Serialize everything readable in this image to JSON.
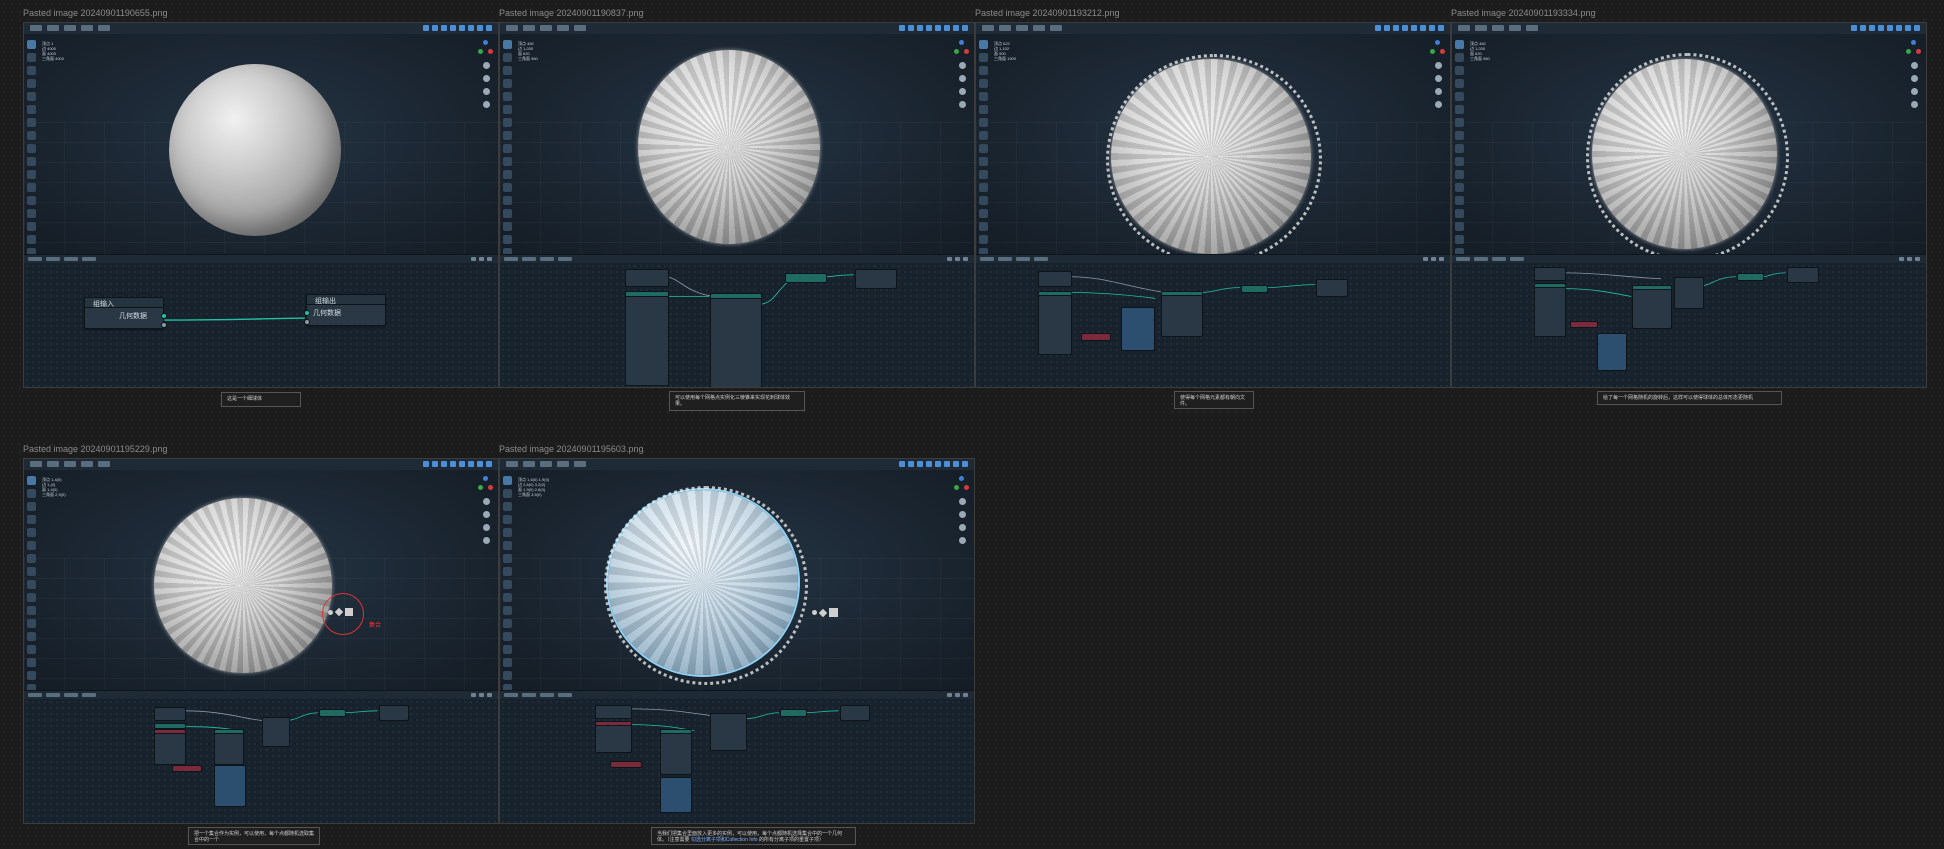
{
  "cards": [
    {
      "title": "Pasted image 20240901190655.png",
      "caption": "这是一个细球体",
      "stats": [
        "顶点 1",
        "边 4000",
        "面 4000",
        "三角面 4000"
      ]
    },
    {
      "title": "Pasted image 20240901190837.png",
      "caption": "可以使用每个网格点实例化三棱锥来实现花刺球体效果。",
      "stats": [
        "顶点 482",
        "边 1,030",
        "面 620",
        "三角面 960"
      ]
    },
    {
      "title": "Pasted image 20240901193212.png",
      "caption": "使得每个网格元素都有朝向文件。",
      "stats": [
        "顶点 622",
        "边 1,102",
        "面 900",
        "三角面 1900"
      ]
    },
    {
      "title": "Pasted image 20240901193334.png",
      "caption": "给了每一个网格随机的旋转后，这样可以使得球体的总体形态更随机",
      "stats": [
        "顶点 482",
        "边 1,030",
        "面 620",
        "三角面 960"
      ]
    },
    {
      "title": "Pasted image 20240901195229.png",
      "caption": "把一个集合作为实例，可以使用，每个点都随机选取集合中的一个",
      "stats": [
        "顶点 1,4(0)",
        "边 1,(0)",
        "面 1,4(0)",
        "三角面 2,9(0)"
      ],
      "annotation": "集合"
    },
    {
      "title": "Pasted image 20240901195603.png",
      "caption_a": "当我们把集合里面放入更多的实例，可以使用，每个点都随机选择集合中的一个几何体。（注意需要",
      "caption_link": "勾选分离子项和Collection Info",
      "caption_b": "的所有分离子项的重置子项）",
      "stats": [
        "顶点 1,6(0) 1,9(0)",
        "边 2,6(0) 3,2(0)",
        "面 1,9(0) 2,6(0)",
        "三角面 3,5(0)"
      ]
    }
  ],
  "node_simple": {
    "input_title": "组输入",
    "input_socket": "几何数据",
    "output_title": "组输出",
    "output_socket": "几何数据"
  },
  "colors": {
    "teal_link": "#21c0a4",
    "accent_blue": "#4c8fd6",
    "annotation_red": "#dd3333"
  }
}
